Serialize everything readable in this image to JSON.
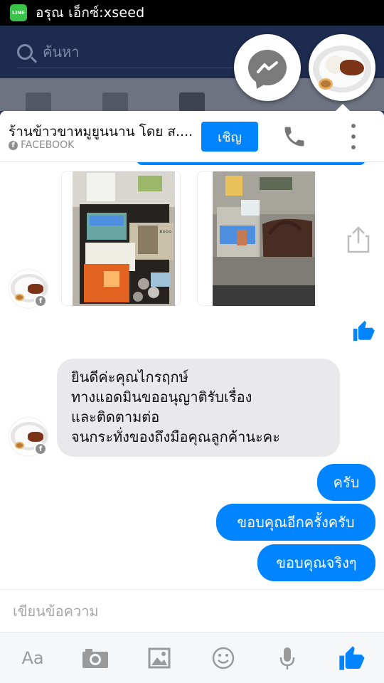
{
  "status_bar": {
    "app_badge": "LINE",
    "text": "อรุณ เอ็กซ์:xseed"
  },
  "background_app": {
    "search_placeholder": "ค้นหา"
  },
  "chat": {
    "title": "ร้านข้าวขาหมูยูนนาน โดย ส....",
    "subtitle": "FACEBOOK",
    "invite_label": "เชิญ"
  },
  "messages": {
    "incoming": [
      "ยินดีค่ะคุณไกรฤกษ์",
      "ทางแอดมินขออนุญาติรับเรื่อง",
      "และติดตามต่อ",
      "จนกระทั่งของถึงมือคุณลูกค้านะคะ"
    ],
    "outgoing": [
      "ครับ",
      "ขอบคุณอีกครั้งครับ",
      "ขอบคุณจริงๆ"
    ],
    "photo_note": "๑๐๐๐"
  },
  "composer": {
    "placeholder": "เขียนข้อความ",
    "text_tool": "Aa"
  },
  "colors": {
    "accent": "#0084ff",
    "incoming_bubble": "#e9e9eb",
    "header_bg": "#1d2b4f"
  },
  "icons": [
    "line-app-icon",
    "search-icon",
    "messenger-icon",
    "phone-icon",
    "more-icon",
    "share-icon",
    "like-icon",
    "camera-icon",
    "gallery-icon",
    "emoji-icon",
    "microphone-icon"
  ]
}
